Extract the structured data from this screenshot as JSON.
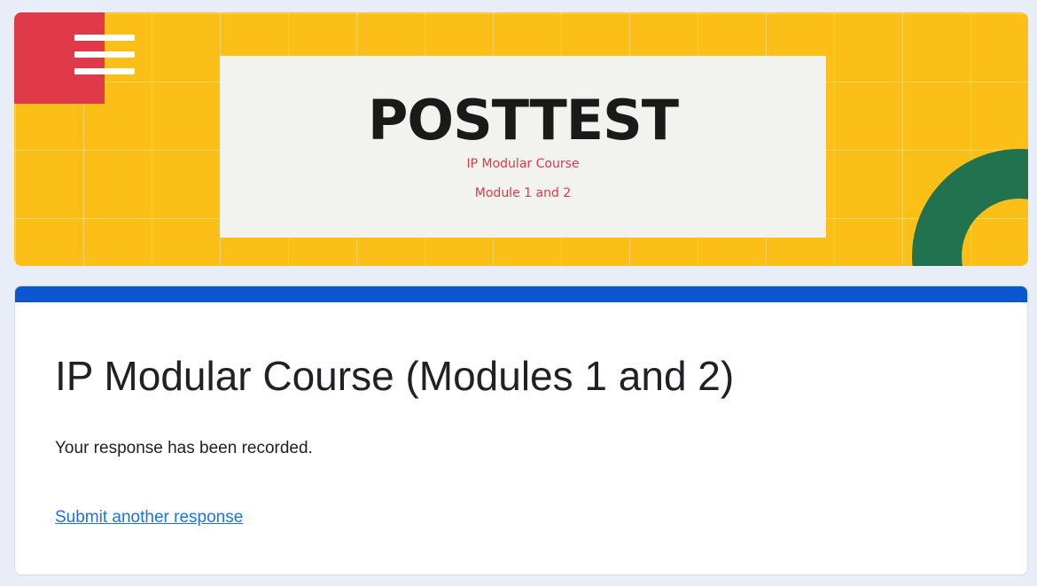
{
  "banner": {
    "title": "POSTTEST",
    "subtitle_line1": "IP Modular Course",
    "subtitle_line2": "Module 1 and 2",
    "menu_icon": "menu-icon"
  },
  "form": {
    "title": "IP Modular Course (Modules 1 and 2)",
    "confirmation_message": "Your response has been recorded.",
    "submit_another_link": "Submit another response"
  },
  "colors": {
    "page_background": "#e8edf8",
    "banner_yellow": "#fbbf17",
    "menu_red": "#e0394a",
    "arc_green": "#217350",
    "accent_blue": "#0b57d0",
    "link_blue": "#1a73e8"
  }
}
